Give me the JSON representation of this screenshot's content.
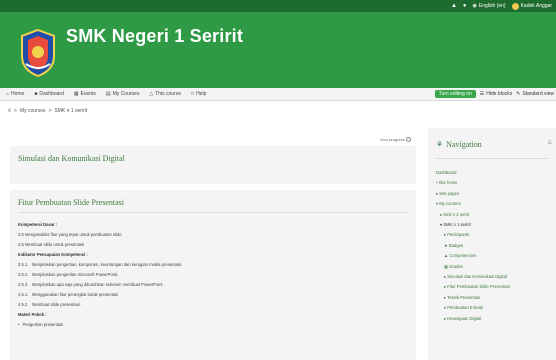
{
  "topbar": {
    "bell_icon": "bell-icon",
    "chat_icon": "chat-icon",
    "language": "English (en)",
    "user_name": "Kadek Anggar"
  },
  "site": {
    "title": "SMK Negeri 1 Seririt"
  },
  "navbar": {
    "items": [
      "Home",
      "Dashboard",
      "Events",
      "My Courses",
      "This course",
      "Help"
    ],
    "turn_editing": "Turn editing on",
    "hide_blocks": "Hide blocks",
    "standard_view": "Standard view"
  },
  "breadcrumb": [
    "My courses",
    "SMK n 1 seririt"
  ],
  "progress": {
    "label": "Your progress"
  },
  "sections": {
    "s1": {
      "title": "Simulasi dan Komunikasi Digital"
    },
    "s2": {
      "title": "Fitur Pembuatan Slide Presentasi",
      "kd_heading": "Kompetensi Dasar :",
      "kd1": "3.5 Menganalisis fitur yang tepat untuk pembuatan slide",
      "kd2": "4.5 Membuat slide untuk presentasi",
      "ind_heading": "Indikator Pencapaian Kompetensi :",
      "ind": [
        {
          "n": "3.5.1.",
          "t": "Menjelaskan pengertian, komponen, keuntungan dan kerugian media presentasi."
        },
        {
          "n": "3.5.2.",
          "t": "Menjelaskan pengertian microsoft PowerPoint."
        },
        {
          "n": "3.5.3",
          "t": "Menjelaskan apa saja yang dibutuhkan sebelum membuat PowerPoint"
        },
        {
          "n": "4.5.1.",
          "t": "Menggunakan fitur perangkat lunak presentasi"
        },
        {
          "n": "4.5.2",
          "t": "Membuat slide presentasi."
        }
      ],
      "materi_heading": "Materi Pokok :",
      "materi1": "Pengertian presentasi"
    }
  },
  "navigation": {
    "title": "Navigation",
    "items": [
      {
        "label": "Dashboard",
        "level": 1
      },
      {
        "label": "Site home",
        "level": 1
      },
      {
        "label": "Site pages",
        "level": 1
      },
      {
        "label": "My courses",
        "level": 1
      },
      {
        "label": "Smk n 2 serrit",
        "level": 2
      },
      {
        "label": "SMK n 1 seririt",
        "level": 2
      },
      {
        "label": "Participants",
        "level": 3
      },
      {
        "label": "Badges",
        "level": 3
      },
      {
        "label": "Competencies",
        "level": 3
      },
      {
        "label": "Grades",
        "level": 3
      },
      {
        "label": "Simulasi dan Komunikasi Digital",
        "level": 3
      },
      {
        "label": "Fitur Pembuatan Slide Presentasi",
        "level": 3
      },
      {
        "label": "Teknik Presentasi",
        "level": 3
      },
      {
        "label": "Pembuatan E-book",
        "level": 3
      },
      {
        "label": "Kewargaan Digital",
        "level": 3
      }
    ]
  },
  "colors": {
    "banner": "#2f9a45",
    "topbar": "#1d6b2e",
    "link": "#3b7a3b",
    "edit_button": "#3aa64a"
  }
}
